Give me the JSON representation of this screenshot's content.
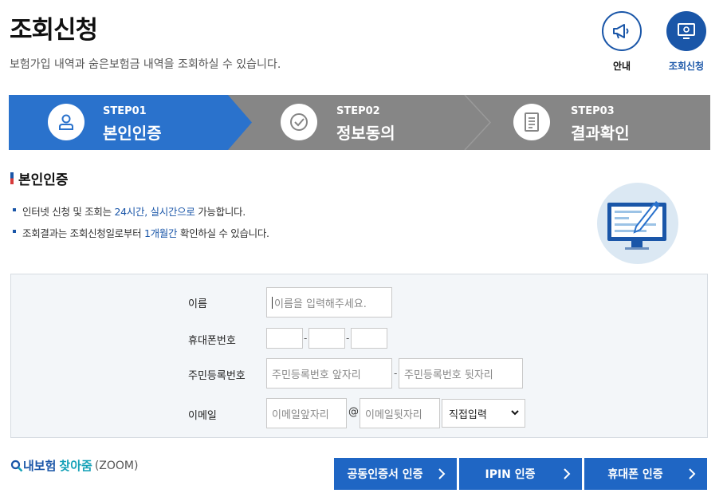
{
  "header": {
    "title": "조회신청",
    "description": "보험가입 내역과 숨은보험금 내역을 조회하실 수 있습니다."
  },
  "top_icons": [
    {
      "label": "안내",
      "icon": "megaphone-icon"
    },
    {
      "label": "조회신청",
      "icon": "monitor-search-icon"
    }
  ],
  "steps": [
    {
      "num": "STEP01",
      "name": "본인인증",
      "icon": "person-icon",
      "active": true
    },
    {
      "num": "STEP02",
      "name": "정보동의",
      "icon": "check-circle-icon",
      "active": false
    },
    {
      "num": "STEP03",
      "name": "결과확인",
      "icon": "document-icon",
      "active": false
    }
  ],
  "section": {
    "title": "본인인증",
    "bullet1": {
      "pre": "인터넷 신청 및 조회는 ",
      "hl": "24시간, 실시간으로",
      "post": " 가능합니다."
    },
    "bullet2": {
      "pre": "조회결과는 조회신청일로부터 ",
      "hl": "1개월간",
      "post": " 확인하실 수 있습니다."
    }
  },
  "form": {
    "name_label": "이름",
    "name_placeholder": "이름을 입력해주세요.",
    "phone_label": "휴대폰번호",
    "rrn_label": "주민등록번호",
    "rrn_front_placeholder": "주민등록번호 앞자리",
    "rrn_back_placeholder": "주민등록번호 뒷자리",
    "email_label": "이메일",
    "email_front_placeholder": "이메일앞자리",
    "email_back_placeholder": "이메일뒷자리",
    "email_domain_selected": "직접입력",
    "dash": "-",
    "at": "@"
  },
  "logo": {
    "part1": "내보험",
    "part2": "찾아줌",
    "part3": "(ZOOM)"
  },
  "buttons": {
    "cert": "공동인증서 인증",
    "ipin": "IPIN 인증",
    "phone": "휴대폰 인증"
  },
  "colors": {
    "primary": "#1f66c4",
    "step_active": "#2a72cc",
    "step_inactive": "#868686",
    "accent_red": "#d73a3a"
  }
}
